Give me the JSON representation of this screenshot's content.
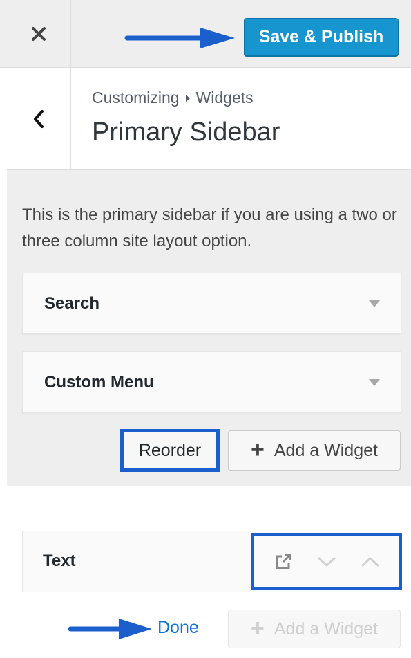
{
  "topbar": {
    "close_icon": "close-icon",
    "save_label": "Save & Publish",
    "arrow_icon": "arrow-right-icon"
  },
  "header": {
    "back_icon": "chevron-left-icon",
    "breadcrumb": {
      "root": "Customizing",
      "separator_icon": "caret-right-icon",
      "section": "Widgets"
    },
    "title": "Primary Sidebar"
  },
  "panel": {
    "description": "This is the primary sidebar if you are using a two or three column site layout option.",
    "widgets": [
      {
        "label": "Search",
        "toggle_icon": "caret-down-icon"
      },
      {
        "label": "Custom Menu",
        "toggle_icon": "caret-down-icon"
      }
    ],
    "reorder_label": "Reorder",
    "add_widget_label": "Add a Widget"
  },
  "reorder_mode": {
    "widget_label": "Text",
    "controls": [
      "external-link-icon",
      "move-down-icon",
      "move-up-icon"
    ],
    "done_label": "Done",
    "add_widget_label": "Add a Widget",
    "add_widget_disabled": true
  },
  "colors": {
    "primary": "#1795cf",
    "highlight": "#1a5fcc",
    "link": "#0a73d9",
    "annotation": "#1a5fcc"
  }
}
